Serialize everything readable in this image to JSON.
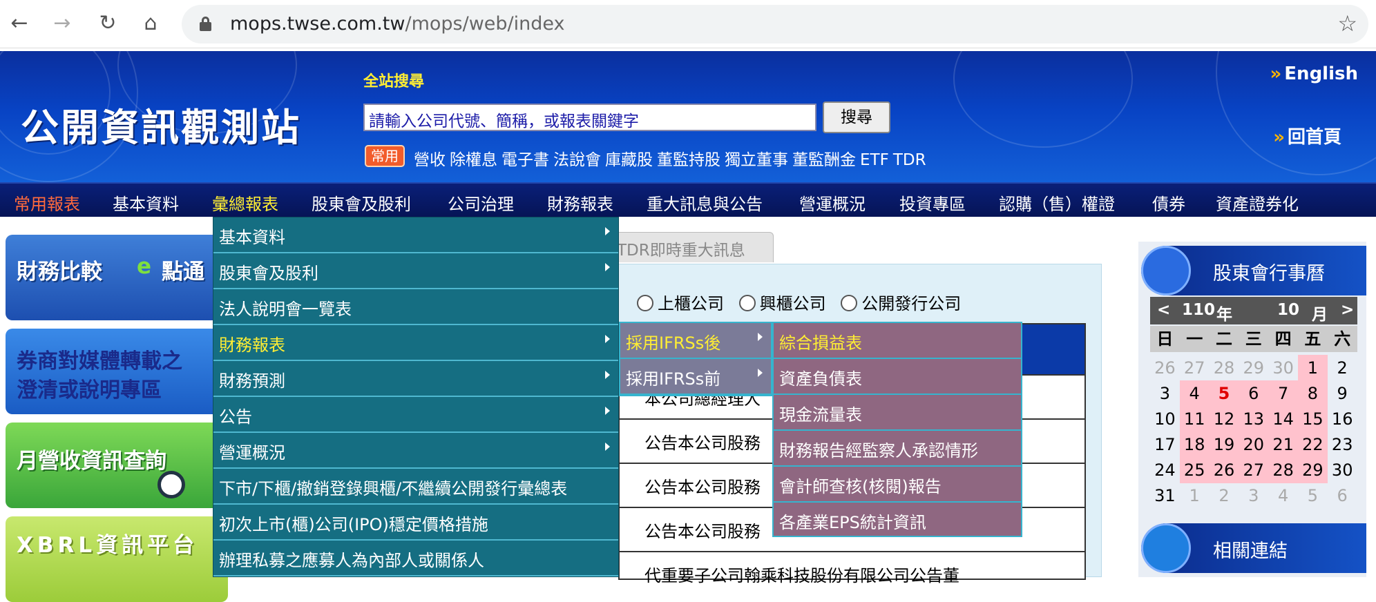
{
  "browser": {
    "url_host": "mops.twse.com.tw",
    "url_path": "/mops/web/index"
  },
  "header": {
    "logo_text": "公開資訊觀測站",
    "search_label": "全站搜尋",
    "search_placeholder": "請輸入公司代號、簡稱，或報表關鍵字",
    "search_button": "搜尋",
    "common_badge": "常用",
    "quick_links": [
      "營收",
      "除權息",
      "電子書",
      "法說會",
      "庫藏股",
      "董監持股",
      "獨立董事",
      "董監酬金",
      "ETF",
      "TDR"
    ],
    "english": "English",
    "home": "回首頁"
  },
  "menubar": [
    "常用報表",
    "基本資料",
    "彙總報表",
    "股東會及股利",
    "公司治理",
    "財務報表",
    "重大訊息與公告",
    "營運概況",
    "投資專區",
    "認購（售）權證",
    "債券",
    "資產證券化"
  ],
  "dropdown_l1": [
    "基本資料",
    "股東會及股利",
    "法人說明會一覽表",
    "財務報表",
    "財務預測",
    "公告",
    "營運概況",
    "下市/下櫃/撤銷登錄興櫃/不繼續公開發行彙總表",
    "初次上市(櫃)公司(IPO)穩定價格措施",
    "辦理私募之應募人為內部人或關係人"
  ],
  "dropdown_l2": [
    "採用IFRSs後",
    "採用IFRSs前"
  ],
  "dropdown_l3": [
    "綜合損益表",
    "資產負債表",
    "現金流量表",
    "財務報告經監察人承認情形",
    "會計師查核(核閱)報告",
    "各產業EPS統計資訊"
  ],
  "left_banners": [
    "財務比較",
    "點通",
    "券商對媒體轉載之",
    "澄清或說明專區",
    "月營收資訊查詢",
    "XBRL資訊平台"
  ],
  "main": {
    "tab_label": "TDR即時重大訊息",
    "radio_labels": [
      "上櫃公司",
      "興櫃公司",
      "公開發行公司"
    ],
    "rows": [
      "本公司總經理人",
      "公告本公司股務",
      "公告本公司股務",
      "公告本公司股務",
      "代重要子公司翰乘科技股份有限公司公告董"
    ]
  },
  "right_sidebar": {
    "section1": "股東會行事曆",
    "section2": "相關連結",
    "calendar": {
      "year": "110",
      "year_unit": "年",
      "month": "10",
      "month_unit": "月",
      "prev": "<",
      "next": ">",
      "weekdays": [
        "日",
        "一",
        "二",
        "三",
        "四",
        "五",
        "六"
      ],
      "days": [
        [
          "26",
          "27",
          "28",
          "29",
          "30",
          "1",
          "2"
        ],
        [
          "3",
          "4",
          "5",
          "6",
          "7",
          "8",
          "9"
        ],
        [
          "10",
          "11",
          "12",
          "13",
          "14",
          "15",
          "16"
        ],
        [
          "17",
          "18",
          "19",
          "20",
          "21",
          "22",
          "23"
        ],
        [
          "24",
          "25",
          "26",
          "27",
          "28",
          "29",
          "30"
        ],
        [
          "31",
          "1",
          "2",
          "3",
          "4",
          "5",
          "6"
        ]
      ]
    }
  },
  "colors": {
    "header_blue": "#0843c4",
    "menubar_navy": "#061456",
    "active_menu": "#ff6a3d",
    "hover_menu": "#ffee33",
    "dropdown_teal": "#156e82",
    "dropdown_lilac": "#8f6781",
    "calendar_pink": "#ffc2cd"
  }
}
